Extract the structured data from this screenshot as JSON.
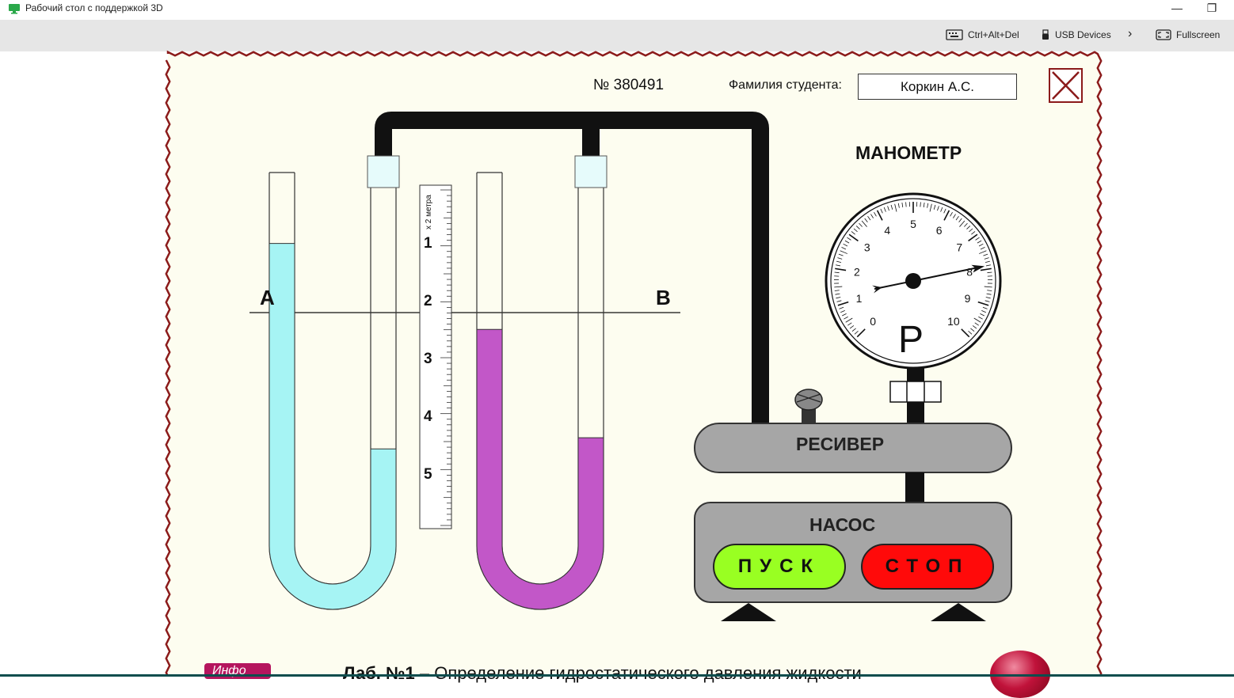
{
  "window": {
    "title": "Рабочий стол с поддержкой 3D",
    "minimize_glyph": "—",
    "restore_glyph": "❐"
  },
  "toolbar": {
    "ctrl_alt_del": "Ctrl+Alt+Del",
    "usb_devices": "USB Devices",
    "chevron": "›",
    "fullscreen": "Fullscreen",
    "icons": [
      "keyboard-icon",
      "usb-icon",
      "chevron-right-icon",
      "fullscreen-icon"
    ]
  },
  "lab": {
    "number_label": "№ 380491",
    "student_label": "Фамилия студента:",
    "student_value": "Коркин А.С.",
    "point_a": "A",
    "point_b": "B",
    "ruler": {
      "unit_label": "х 2 метра",
      "marks": [
        "1",
        "2",
        "3",
        "4",
        "5"
      ]
    },
    "left_tube": {
      "color": "#a6f4f4",
      "left_level_fraction": 0.19,
      "right_level_fraction": 0.74
    },
    "right_tube": {
      "color": "#c257c8",
      "left_level_fraction": 0.42,
      "right_level_fraction": 0.71
    }
  },
  "manometer": {
    "title": "МАНОМЕТР",
    "symbol": "P",
    "scale": [
      "0",
      "1",
      "2",
      "3",
      "4",
      "5",
      "6",
      "7",
      "8",
      "9",
      "10"
    ],
    "reading": 7.9
  },
  "receiver": {
    "label": "РЕСИВЕР"
  },
  "pump": {
    "label": "НАСОС",
    "start_label": "ПУСК",
    "stop_label": "СТОП"
  },
  "footer": {
    "info_badge": "Инфо",
    "title_prefix": "Лаб. №1",
    "title_text": "Определение гидростатического давления жидкости"
  },
  "colors": {
    "frame_border": "#8b1a1a",
    "panel_bg": "#fdfdf0",
    "device_gray": "#a0a0a0",
    "start_green": "#99ff22",
    "stop_red": "#ff0a0a"
  }
}
